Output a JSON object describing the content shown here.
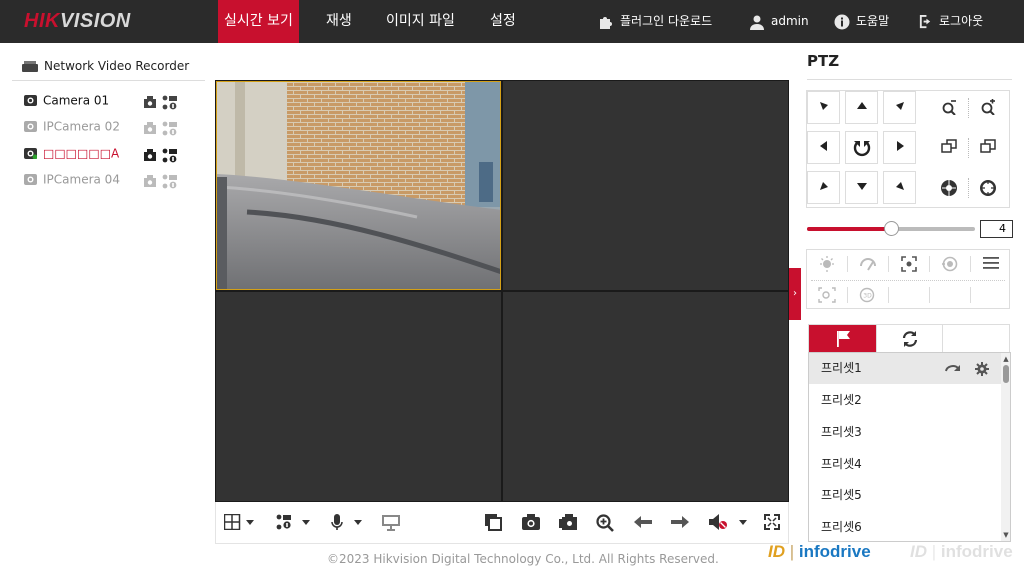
{
  "app": {
    "logo_red": "HIK",
    "logo_rest": "VISION"
  },
  "nav": {
    "items": [
      {
        "label": "실시간 보기",
        "active": true
      },
      {
        "label": "재생",
        "active": false
      },
      {
        "label": "이미지 파일",
        "active": false
      },
      {
        "label": "설정",
        "active": false
      }
    ]
  },
  "topright": {
    "plugin_label": "플러그인 다운로드",
    "user_label": "admin",
    "help_label": "도움말",
    "logout_label": "로그아웃"
  },
  "device_tree": {
    "root_label": "Network Video Recorder",
    "cameras": [
      {
        "label": "Camera 01",
        "color": "#111111",
        "status": "online"
      },
      {
        "label": "IPCamera 02",
        "color": "#999999",
        "status": "offline"
      },
      {
        "label": "□□□□□□A",
        "color": "#c8102e",
        "status": "recording"
      },
      {
        "label": "IPCamera 04",
        "color": "#999999",
        "status": "offline"
      }
    ]
  },
  "ptz": {
    "title": "PTZ",
    "speed": 4,
    "speed_max": 7,
    "speed_box": "4",
    "presets": [
      "프리셋1",
      "프리셋2",
      "프리셋3",
      "프리셋4",
      "프리셋5",
      "프리셋6"
    ]
  },
  "footer": {
    "copyright": "©2023 Hikvision Digital Technology Co., Ltd. All Rights Reserved."
  },
  "watermark": {
    "mark": "ID",
    "brand": "infodrive",
    "mark_faded": "ID",
    "brand_faded": "infodrive"
  },
  "colors": {
    "accent": "#c8102e",
    "topbar": "#2b2b2b",
    "video_bg": "#333333",
    "selected_border": "#d4a017"
  },
  "icons": {
    "nav_collapse": "chevron-right-icon",
    "preset_tab": "flag-icon",
    "patrol_tab": "refresh-icon"
  }
}
